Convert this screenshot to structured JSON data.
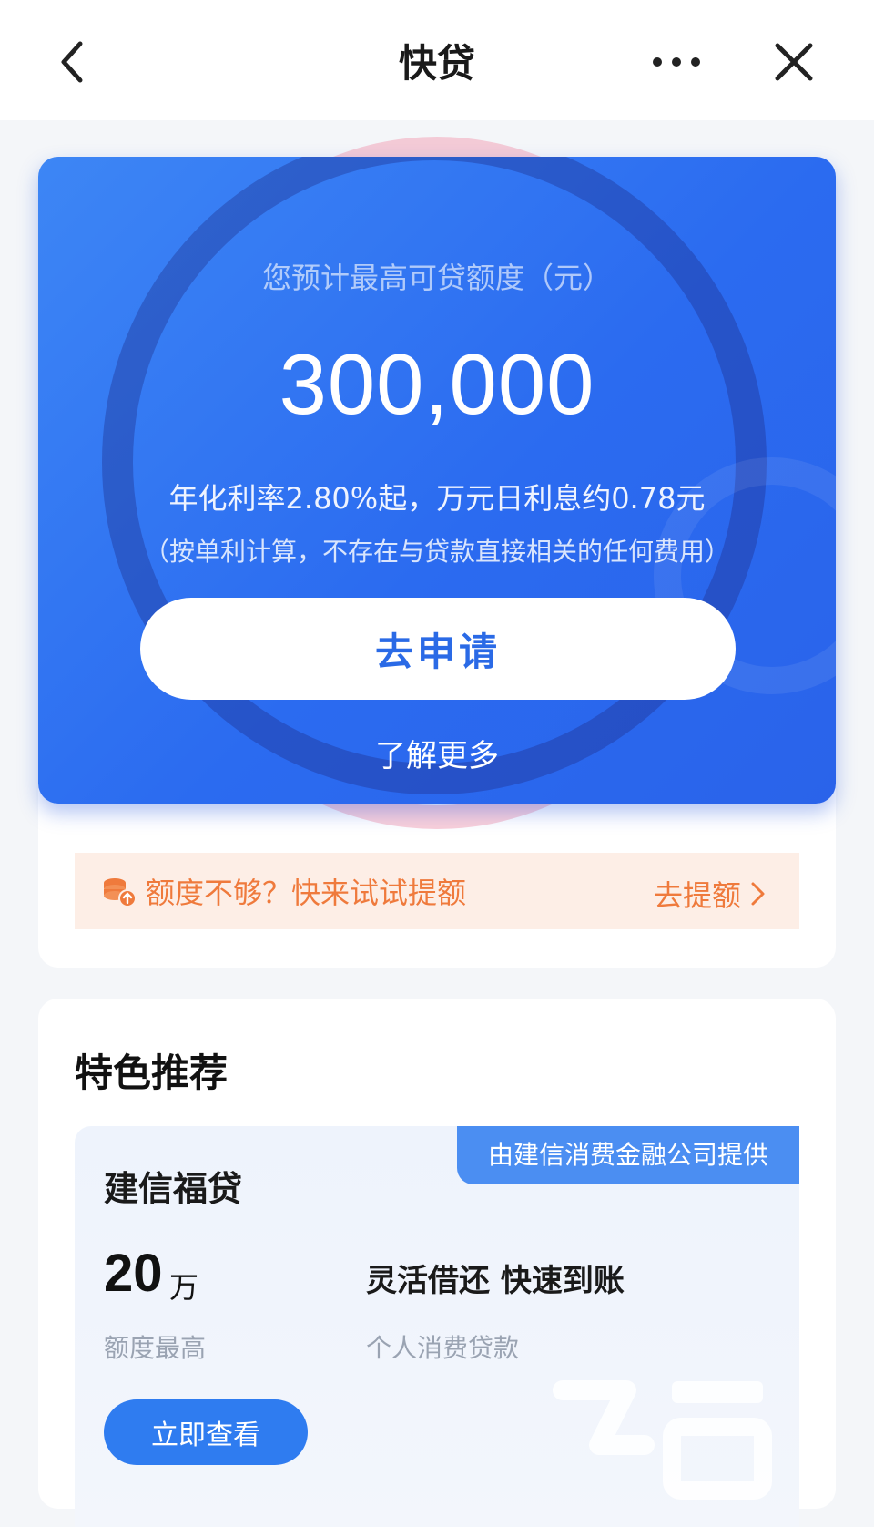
{
  "nav": {
    "title": "快贷"
  },
  "card": {
    "label": "您预计最高可贷额度（元）",
    "amount": "300,000",
    "rate": "年化利率2.80%起，万元日利息约0.78元",
    "note": "（按单利计算，不存在与贷款直接相关的任何费用）",
    "apply_label": "去申请",
    "learn_more": "了解更多"
  },
  "tip": {
    "text": "额度不够？快来试试提额",
    "action": "去提额"
  },
  "featured": {
    "title": "特色推荐",
    "product": {
      "badge": "由建信消费金融公司提供",
      "name": "建信福贷",
      "limit_number": "20",
      "limit_unit": "万",
      "limit_label": "额度最高",
      "feature": "灵活借还 快速到账",
      "feature_sub": "个人消费贷款",
      "view_label": "立即查看"
    }
  },
  "colors": {
    "primary": "#2a6ae6",
    "accent": "#ef7a3c"
  }
}
